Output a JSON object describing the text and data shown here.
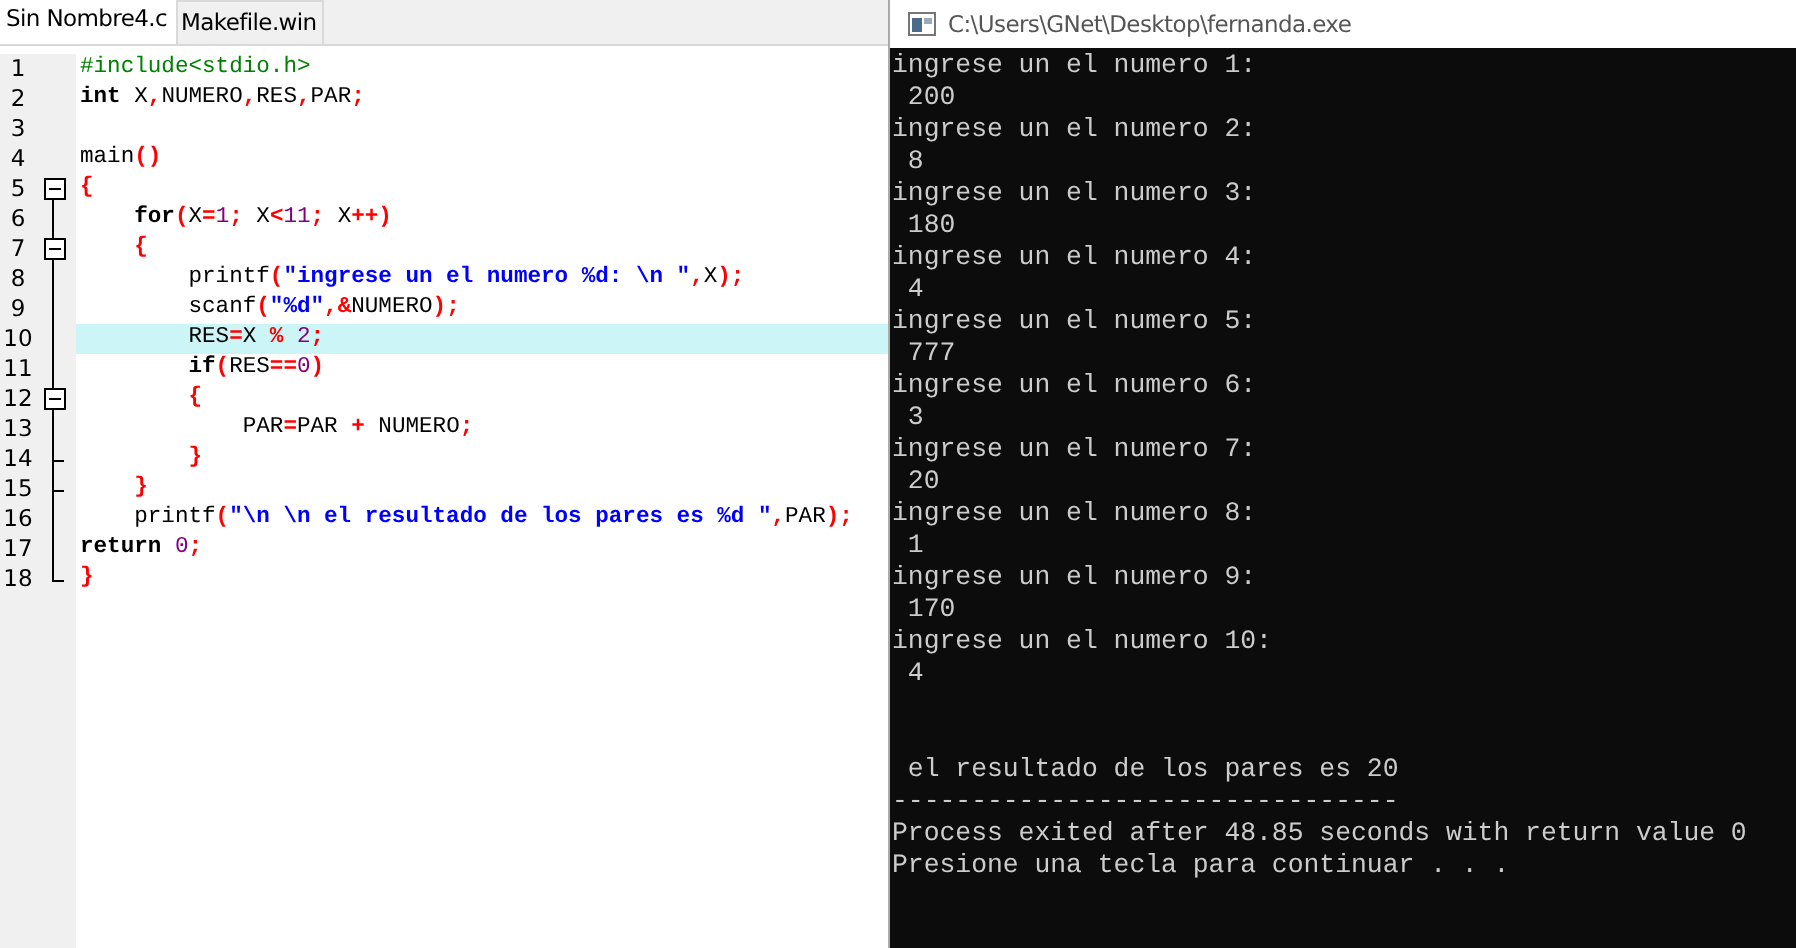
{
  "editor": {
    "tabs": [
      {
        "label": "Sin Nombre4.c",
        "selected": true
      },
      {
        "label": "Makefile.win",
        "selected": false
      }
    ],
    "lines": [
      {
        "number": "1",
        "kind": "plain",
        "selected": false,
        "tokens": [
          {
            "kind": "pre",
            "text": "#include<stdio.h>"
          }
        ]
      },
      {
        "number": "2",
        "kind": "plain",
        "selected": false,
        "tokens": [
          {
            "kind": "kw",
            "text": "int"
          },
          {
            "kind": "id",
            "text": " X"
          },
          {
            "kind": "op",
            "text": ","
          },
          {
            "kind": "id",
            "text": "NUMERO"
          },
          {
            "kind": "op",
            "text": ","
          },
          {
            "kind": "id",
            "text": "RES"
          },
          {
            "kind": "op",
            "text": ","
          },
          {
            "kind": "id",
            "text": "PAR"
          },
          {
            "kind": "op",
            "text": ";"
          }
        ]
      },
      {
        "number": "3",
        "kind": "plain",
        "selected": false
      },
      {
        "number": "4",
        "kind": "plain",
        "selected": false,
        "tokens": [
          {
            "kind": "id",
            "text": "main"
          },
          {
            "kind": "op",
            "text": "()"
          }
        ]
      },
      {
        "number": "5",
        "kind": "fold-start",
        "selected": false,
        "tokens": [
          {
            "kind": "op",
            "text": "{"
          }
        ]
      },
      {
        "number": "6",
        "kind": "fold-body",
        "selected": false,
        "tokens": [
          {
            "kind": "kw",
            "text": "    for"
          },
          {
            "kind": "op",
            "text": "("
          },
          {
            "kind": "id",
            "text": "X"
          },
          {
            "kind": "op",
            "text": "="
          },
          {
            "kind": "num",
            "text": "1"
          },
          {
            "kind": "op",
            "text": ";"
          },
          {
            "kind": "id",
            "text": " X"
          },
          {
            "kind": "op",
            "text": "<"
          },
          {
            "kind": "num",
            "text": "11"
          },
          {
            "kind": "op",
            "text": ";"
          },
          {
            "kind": "id",
            "text": " X"
          },
          {
            "kind": "op",
            "text": "++)"
          }
        ]
      },
      {
        "number": "7",
        "kind": "fold-inner-start",
        "selected": false,
        "tokens": [
          {
            "kind": "op",
            "text": "    {"
          }
        ]
      },
      {
        "number": "8",
        "kind": "fold-body",
        "selected": false,
        "tokens": [
          {
            "kind": "id",
            "text": "        printf"
          },
          {
            "kind": "op",
            "text": "("
          },
          {
            "kind": "str",
            "text": "\"ingrese un el numero %d: \\n \""
          },
          {
            "kind": "op",
            "text": ","
          },
          {
            "kind": "id",
            "text": "X"
          },
          {
            "kind": "op",
            "text": ");"
          }
        ]
      },
      {
        "number": "9",
        "kind": "fold-body",
        "selected": false,
        "tokens": [
          {
            "kind": "id",
            "text": "        scanf"
          },
          {
            "kind": "op",
            "text": "("
          },
          {
            "kind": "str",
            "text": "\"%d\""
          },
          {
            "kind": "op",
            "text": ",&"
          },
          {
            "kind": "id",
            "text": "NUMERO"
          },
          {
            "kind": "op",
            "text": ");"
          }
        ]
      },
      {
        "number": "10",
        "kind": "fold-body",
        "selected": true,
        "tokens": [
          {
            "kind": "id",
            "text": "        RES"
          },
          {
            "kind": "op",
            "text": "="
          },
          {
            "kind": "id",
            "text": "X "
          },
          {
            "kind": "op",
            "text": "%"
          },
          {
            "kind": "num",
            "text": " 2"
          },
          {
            "kind": "op",
            "text": ";"
          }
        ]
      },
      {
        "number": "11",
        "kind": "fold-body",
        "selected": false,
        "tokens": [
          {
            "kind": "kw",
            "text": "        if"
          },
          {
            "kind": "op",
            "text": "("
          },
          {
            "kind": "id",
            "text": "RES"
          },
          {
            "kind": "op",
            "text": "=="
          },
          {
            "kind": "num",
            "text": "0"
          },
          {
            "kind": "op",
            "text": ")"
          }
        ]
      },
      {
        "number": "12",
        "kind": "fold-inner-start",
        "selected": false,
        "tokens": [
          {
            "kind": "op",
            "text": "        {"
          }
        ]
      },
      {
        "number": "13",
        "kind": "fold-body",
        "selected": false,
        "tokens": [
          {
            "kind": "id",
            "text": "            PAR"
          },
          {
            "kind": "op",
            "text": "="
          },
          {
            "kind": "id",
            "text": "PAR "
          },
          {
            "kind": "op",
            "text": "+"
          },
          {
            "kind": "id",
            "text": " NUMERO"
          },
          {
            "kind": "op",
            "text": ";"
          }
        ]
      },
      {
        "number": "14",
        "kind": "fold-inner-end",
        "selected": false,
        "tokens": [
          {
            "kind": "op",
            "text": "        }"
          }
        ]
      },
      {
        "number": "15",
        "kind": "fold-inner-end",
        "selected": false,
        "tokens": [
          {
            "kind": "op",
            "text": "    }"
          }
        ]
      },
      {
        "number": "16",
        "kind": "fold-body",
        "selected": false,
        "tokens": [
          {
            "kind": "id",
            "text": "    printf"
          },
          {
            "kind": "op",
            "text": "("
          },
          {
            "kind": "str",
            "text": "\"\\n \\n el resultado de los pares es %d \""
          },
          {
            "kind": "op",
            "text": ","
          },
          {
            "kind": "id",
            "text": "PAR"
          },
          {
            "kind": "op",
            "text": ");"
          }
        ]
      },
      {
        "number": "17",
        "kind": "fold-body",
        "selected": false,
        "tokens": [
          {
            "kind": "kw",
            "text": "return"
          },
          {
            "kind": "num",
            "text": " 0"
          },
          {
            "kind": "op",
            "text": ";"
          }
        ]
      },
      {
        "number": "18",
        "kind": "fold-end",
        "selected": false,
        "tokens": [
          {
            "kind": "op",
            "text": "}"
          }
        ]
      }
    ]
  },
  "console": {
    "title": "C:\\Users\\GNet\\Desktop\\fernanda.exe",
    "lines": [
      {
        "kind": "prompt",
        "text": "ingrese un el numero 1:"
      },
      {
        "kind": "input",
        "text": " 200"
      },
      {
        "kind": "prompt",
        "text": "ingrese un el numero 2:"
      },
      {
        "kind": "input",
        "text": " 8"
      },
      {
        "kind": "prompt",
        "text": "ingrese un el numero 3:"
      },
      {
        "kind": "input",
        "text": " 180"
      },
      {
        "kind": "prompt",
        "text": "ingrese un el numero 4:"
      },
      {
        "kind": "input",
        "text": " 4"
      },
      {
        "kind": "prompt",
        "text": "ingrese un el numero 5:"
      },
      {
        "kind": "input",
        "text": " 777"
      },
      {
        "kind": "prompt",
        "text": "ingrese un el numero 6:"
      },
      {
        "kind": "input",
        "text": " 3"
      },
      {
        "kind": "prompt",
        "text": "ingrese un el numero 7:"
      },
      {
        "kind": "input",
        "text": " 20"
      },
      {
        "kind": "prompt",
        "text": "ingrese un el numero 8:"
      },
      {
        "kind": "input",
        "text": " 1"
      },
      {
        "kind": "prompt",
        "text": "ingrese un el numero 9:"
      },
      {
        "kind": "input",
        "text": " 170"
      },
      {
        "kind": "prompt",
        "text": "ingrese un el numero 10:"
      },
      {
        "kind": "input",
        "text": " 4"
      },
      {
        "kind": "result",
        "text": " el resultado de los pares es 20"
      },
      {
        "kind": "separator",
        "text": "--------------------------------"
      },
      {
        "kind": "status",
        "text": "Process exited after 48.85 seconds with return value 0"
      },
      {
        "kind": "status",
        "text": "Presione una tecla para continuar . . ."
      }
    ]
  }
}
